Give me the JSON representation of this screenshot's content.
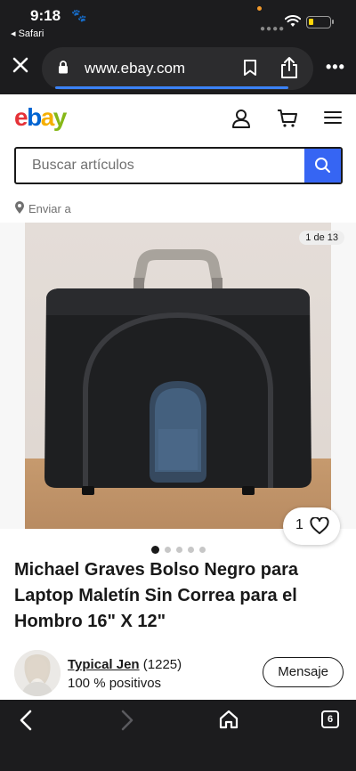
{
  "status_bar": {
    "time": "9:18",
    "back_app": "◂ Safari"
  },
  "browser": {
    "url": "www.ebay.com",
    "tabs_count": "6"
  },
  "header": {
    "logo_letters": [
      {
        "char": "e",
        "color": "#e53238"
      },
      {
        "char": "b",
        "color": "#0064d2"
      },
      {
        "char": "a",
        "color": "#f5af02"
      },
      {
        "char": "y",
        "color": "#86b817"
      }
    ]
  },
  "search": {
    "placeholder": "Buscar artículos"
  },
  "shipping": {
    "label": "Enviar a"
  },
  "gallery": {
    "counter": "1 de 13",
    "likes": "1",
    "dot_count": 5,
    "active_dot": 0
  },
  "listing": {
    "title": "Michael Graves Bolso Negro para Laptop Maletín Sin Correa para el Hombro 16\" X 12\""
  },
  "seller": {
    "name": "Typical Jen",
    "feedback_count": "(1225)",
    "positive": "100 % positivos",
    "message_button": "Mensaje"
  }
}
